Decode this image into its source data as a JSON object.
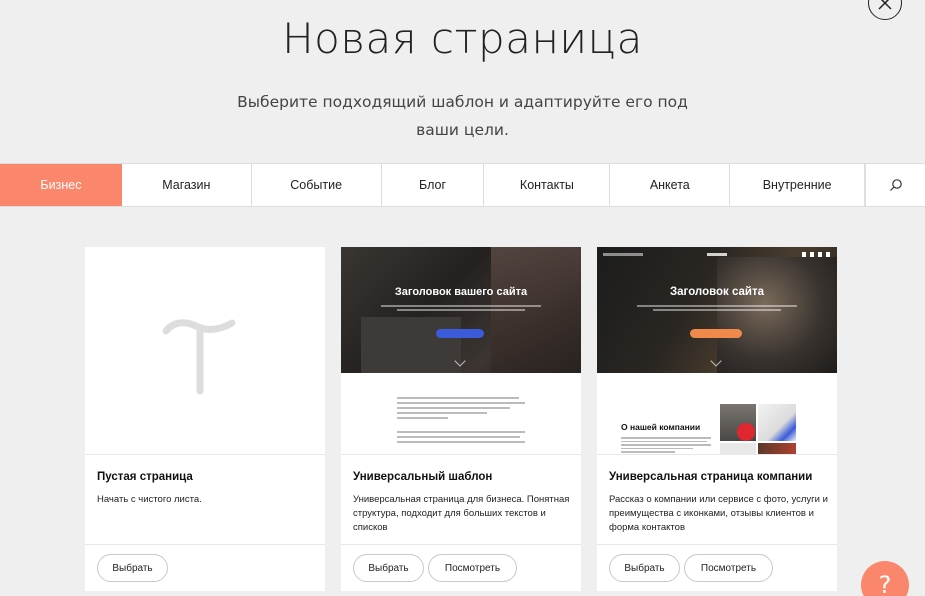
{
  "header": {
    "title": "Новая страница",
    "subtitle_line1": "Выберите подходящий шаблон и адаптируйте его под",
    "subtitle_line2": "ваши цели."
  },
  "tabs": [
    {
      "label": "Бизнес",
      "active": true
    },
    {
      "label": "Магазин",
      "active": false
    },
    {
      "label": "Событие",
      "active": false
    },
    {
      "label": "Блог",
      "active": false
    },
    {
      "label": "Контакты",
      "active": false
    },
    {
      "label": "Анкета",
      "active": false
    },
    {
      "label": "Внутренние",
      "active": false
    }
  ],
  "cards": [
    {
      "name": "Пустая страница",
      "description": "Начать с чистого листа.",
      "buttons": {
        "select": "Выбрать"
      }
    },
    {
      "name": "Универсальный шаблон",
      "description": "Универсальная страница для бизнеса. Понятная структура, подходит для больших текстов и списков",
      "buttons": {
        "select": "Выбрать",
        "preview": "Посмотреть"
      },
      "preview": {
        "hero_title": "Заголовок вашего сайта"
      }
    },
    {
      "name": "Универсальная страница компании",
      "description": "Рассказ о компании или сервисе с фото, услуги и преимущества с иконками, отзывы клиентов и форма контактов",
      "buttons": {
        "select": "Выбрать",
        "preview": "Посмотреть"
      },
      "preview": {
        "hero_title": "Заголовок сайта",
        "section_title": "О нашей компании"
      }
    }
  ],
  "icons": {
    "close": "close-icon",
    "search": "search-icon",
    "help": "help-icon",
    "help_glyph": "?"
  },
  "colors": {
    "accent": "#fa876b",
    "background": "#efefef",
    "blue_button": "#3b5bdb",
    "orange_button": "#f08a4b"
  }
}
